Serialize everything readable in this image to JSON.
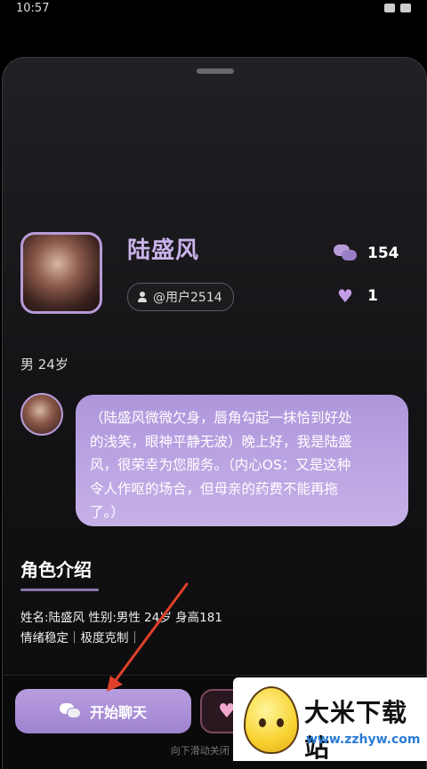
{
  "status_bar": {
    "time": "10:57"
  },
  "profile": {
    "name": "陆盛风",
    "user_tag": "@用户2514",
    "chat_count": "154",
    "like_count": "1",
    "gender_age": "男 24岁"
  },
  "greeting": {
    "lines": [
      "（陆盛风微微欠身，唇角勾起一抹恰到好处",
      "的浅笑，眼神平静无波）晚上好，我是陆盛",
      "风，很荣幸为您服务。（内心OS：又是这种",
      "令人作呕的场合，但母亲的药费不能再拖",
      "了。）"
    ]
  },
  "intro": {
    "title": "角色介绍",
    "line1": "姓名:陆盛风 性别:男性 24岁 身高181",
    "line2": "情绪稳定｜极度克制｜"
  },
  "bottom": {
    "start_chat_label": "开始聊天",
    "hint": "向下滑动关闭 · 成点"
  },
  "watermark": {
    "title": "大米下载站",
    "url": "www.zzhyw.com"
  },
  "colors": {
    "accent": "#b79bd8",
    "bubble": "#b8a2e0",
    "name": "#c9b3ea"
  }
}
